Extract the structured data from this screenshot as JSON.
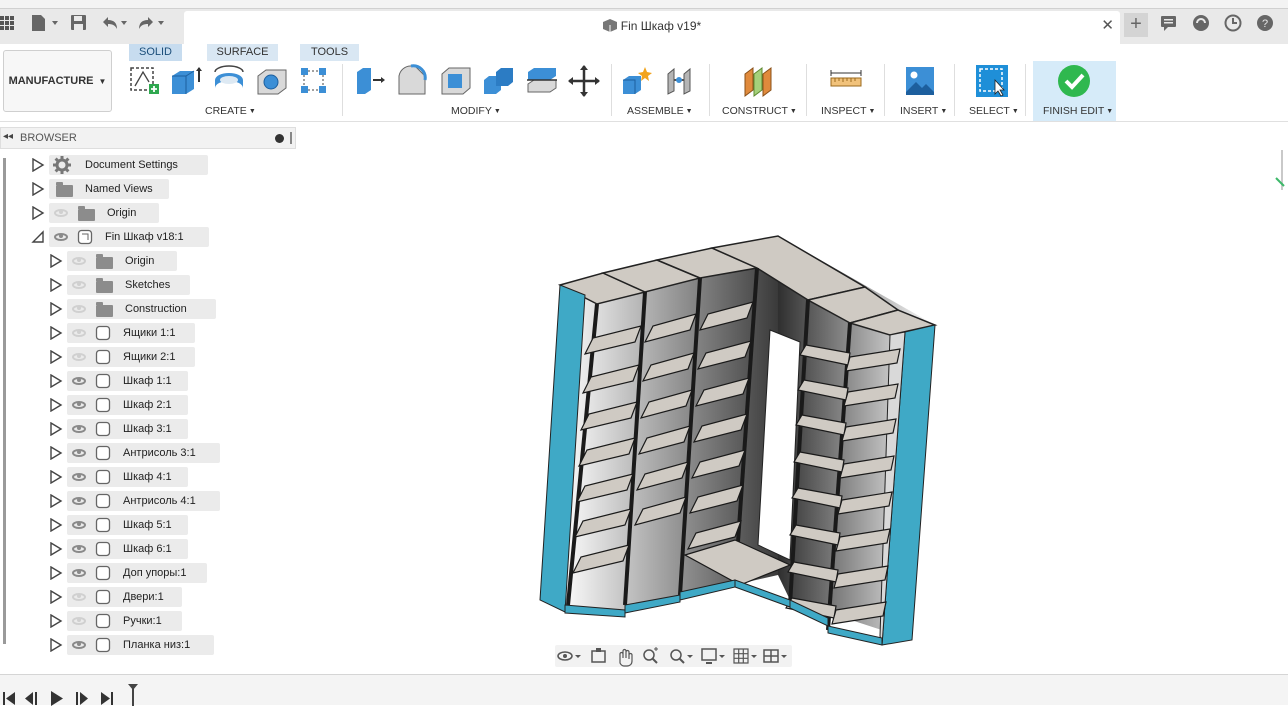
{
  "app": {
    "document_title": "Fin Шкаф v19*"
  },
  "toolbar": {
    "workspace": "MANUFACTURE",
    "tabs": [
      "SOLID",
      "SURFACE",
      "TOOLS"
    ],
    "groups": [
      "CREATE",
      "MODIFY",
      "ASSEMBLE",
      "CONSTRUCT",
      "INSPECT",
      "INSERT",
      "SELECT",
      "FINISH EDIT"
    ]
  },
  "browser": {
    "title": "BROWSER",
    "items": [
      {
        "label": "Document Settings",
        "level": 0,
        "icon": "gear-icon",
        "visible": null
      },
      {
        "label": "Named Views",
        "level": 0,
        "icon": "folder-icon",
        "visible": null
      },
      {
        "label": "Origin",
        "level": 0,
        "icon": "folder-icon",
        "visible": false
      },
      {
        "label": "Fin Шкаф v18:1",
        "level": 0,
        "icon": "component-icon",
        "visible": true,
        "expanded": true
      },
      {
        "label": "Origin",
        "level": 1,
        "icon": "folder-icon",
        "visible": false
      },
      {
        "label": "Sketches",
        "level": 1,
        "icon": "folder-icon",
        "visible": false
      },
      {
        "label": "Construction",
        "level": 1,
        "icon": "folder-icon",
        "visible": false
      },
      {
        "label": "Ящики 1:1",
        "level": 1,
        "icon": "component-icon",
        "visible": false
      },
      {
        "label": "Ящики 2:1",
        "level": 1,
        "icon": "component-icon",
        "visible": false
      },
      {
        "label": "Шкаф 1:1",
        "level": 1,
        "icon": "component-icon",
        "visible": true
      },
      {
        "label": "Шкаф 2:1",
        "level": 1,
        "icon": "component-icon",
        "visible": true
      },
      {
        "label": "Шкаф 3:1",
        "level": 1,
        "icon": "component-icon",
        "visible": true
      },
      {
        "label": "Антрисоль 3:1",
        "level": 1,
        "icon": "component-icon",
        "visible": true
      },
      {
        "label": "Шкаф 4:1",
        "level": 1,
        "icon": "component-icon",
        "visible": true
      },
      {
        "label": "Антрисоль 4:1",
        "level": 1,
        "icon": "component-icon",
        "visible": true
      },
      {
        "label": "Шкаф 5:1",
        "level": 1,
        "icon": "component-icon",
        "visible": true
      },
      {
        "label": "Шкаф 6:1",
        "level": 1,
        "icon": "component-icon",
        "visible": true
      },
      {
        "label": "Доп упоры:1",
        "level": 1,
        "icon": "component-icon",
        "visible": true
      },
      {
        "label": "Двери:1",
        "level": 1,
        "icon": "component-icon",
        "visible": false
      },
      {
        "label": "Ручки:1",
        "level": 1,
        "icon": "component-icon",
        "visible": false
      },
      {
        "label": "Планка низ:1",
        "level": 1,
        "icon": "component-icon",
        "visible": true
      }
    ]
  },
  "colors": {
    "accent_tab": "#c7dcef",
    "finish_bg": "#d6ebf9",
    "panel_edge": "#3fa9c6",
    "shelf": "#cfcac3"
  }
}
